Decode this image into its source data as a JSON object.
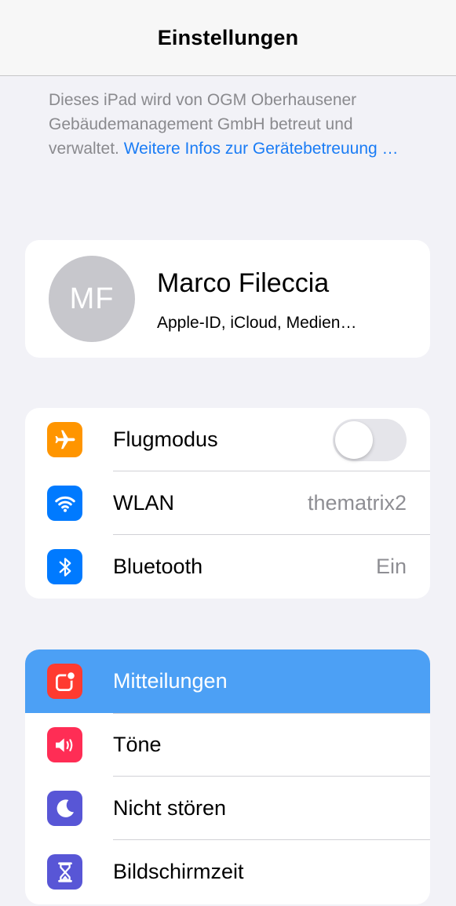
{
  "navbar": {
    "title": "Einstellungen"
  },
  "management": {
    "text": "Dieses iPad wird von OGM Oberhausener Gebäudemanagement GmbH betreut und verwaltet.",
    "link": "Weitere Infos zur Gerätebetreuung …"
  },
  "profile": {
    "initials": "MF",
    "name": "Marco Fileccia",
    "subtitle": "Apple-ID, iCloud, Medien…"
  },
  "connectivity": [
    {
      "label": "Flugmodus",
      "icon": "airplane-icon",
      "color": "#ff9500",
      "toggle": false
    },
    {
      "label": "WLAN",
      "icon": "wifi-icon",
      "color": "#007aff",
      "value": "thematrix2"
    },
    {
      "label": "Bluetooth",
      "icon": "bluetooth-icon",
      "color": "#007aff",
      "value": "Ein"
    }
  ],
  "apps": [
    {
      "label": "Mitteilungen",
      "icon": "notifications-icon",
      "color": "#ff3b30",
      "selected": true
    },
    {
      "label": "Töne",
      "icon": "speaker-icon",
      "color": "#ff2d55"
    },
    {
      "label": "Nicht stören",
      "icon": "moon-icon",
      "color": "#5856d6"
    },
    {
      "label": "Bildschirmzeit",
      "icon": "hourglass-icon",
      "color": "#5856d6"
    }
  ],
  "colors": {
    "background": "#f2f2f7",
    "accent": "#007aff",
    "selection": "#4ca0f5"
  }
}
